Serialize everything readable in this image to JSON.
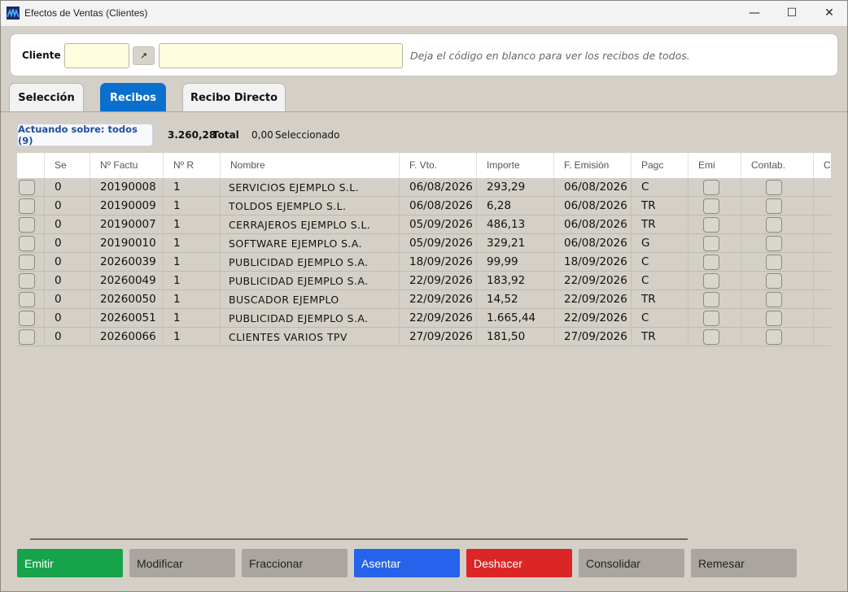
{
  "window": {
    "title": "Efectos de Ventas (Clientes)",
    "minimize_glyph": "—",
    "maximize_glyph": "☐",
    "close_glyph": "✕"
  },
  "client": {
    "label": "Cliente",
    "code_value": "",
    "name_value": "",
    "link_glyph": "↗",
    "hint": "Deja el código en blanco para ver los recibos de todos."
  },
  "tabs": [
    {
      "label": "Selección",
      "active": false
    },
    {
      "label": "Recibos",
      "active": true
    },
    {
      "label": "Recibo Directo",
      "active": false
    }
  ],
  "status": {
    "acting": "Actuando sobre: todos (9)",
    "total_amount": "3.260,28",
    "total_label": "Total",
    "selected_amount": "0,00",
    "selected_label": "Seleccionado"
  },
  "grid": {
    "headers": [
      "Se",
      "Nº Factu",
      "Nº R",
      "Nombre",
      "F. Vto.",
      "Importe",
      "F. Emisión",
      "Pagc",
      "Emi",
      "Contab.",
      "Co"
    ],
    "rows": [
      {
        "serie": "0",
        "factura": "20190008",
        "recibo": "1",
        "nombre": "SERVICIOS EJEMPLO S.L.",
        "vto": "06/08/2026",
        "importe": "293,29",
        "emision": "06/08/2026",
        "pago": "C"
      },
      {
        "serie": "0",
        "factura": "20190009",
        "recibo": "1",
        "nombre": "TOLDOS EJEMPLO S.L.",
        "vto": "06/08/2026",
        "importe": "6,28",
        "emision": "06/08/2026",
        "pago": "TR"
      },
      {
        "serie": "0",
        "factura": "20190007",
        "recibo": "1",
        "nombre": "CERRAJEROS EJEMPLO S.L.",
        "vto": "05/09/2026",
        "importe": "486,13",
        "emision": "06/08/2026",
        "pago": "TR"
      },
      {
        "serie": "0",
        "factura": "20190010",
        "recibo": "1",
        "nombre": "SOFTWARE EJEMPLO S.A.",
        "vto": "05/09/2026",
        "importe": "329,21",
        "emision": "06/08/2026",
        "pago": "G"
      },
      {
        "serie": "0",
        "factura": "20260039",
        "recibo": "1",
        "nombre": "PUBLICIDAD EJEMPLO S.A.",
        "vto": "18/09/2026",
        "importe": "99,99",
        "emision": "18/09/2026",
        "pago": "C"
      },
      {
        "serie": "0",
        "factura": "20260049",
        "recibo": "1",
        "nombre": "PUBLICIDAD EJEMPLO S.A.",
        "vto": "22/09/2026",
        "importe": "183,92",
        "emision": "22/09/2026",
        "pago": "C"
      },
      {
        "serie": "0",
        "factura": "20260050",
        "recibo": "1",
        "nombre": "BUSCADOR EJEMPLO",
        "vto": "22/09/2026",
        "importe": "14,52",
        "emision": "22/09/2026",
        "pago": "TR"
      },
      {
        "serie": "0",
        "factura": "20260051",
        "recibo": "1",
        "nombre": "PUBLICIDAD EJEMPLO S.A.",
        "vto": "22/09/2026",
        "importe": "1.665,44",
        "emision": "22/09/2026",
        "pago": "C"
      },
      {
        "serie": "0",
        "factura": "20260066",
        "recibo": "1",
        "nombre": "CLIENTES VARIOS TPV",
        "vto": "27/09/2026",
        "importe": "181,50",
        "emision": "27/09/2026",
        "pago": "TR"
      }
    ]
  },
  "actions": [
    {
      "label": "Emitir",
      "color": "#16a34a",
      "text_color": "#ffffff"
    },
    {
      "label": "Modificar",
      "color": "#aaa69f",
      "text_color": "#222222"
    },
    {
      "label": "Fraccionar",
      "color": "#aaa69f",
      "text_color": "#222222"
    },
    {
      "label": "Asentar",
      "color": "#2563eb",
      "text_color": "#ffffff"
    },
    {
      "label": "Deshacer",
      "color": "#dc2626",
      "text_color": "#ffffff"
    },
    {
      "label": "Consolidar",
      "color": "#aaa69f",
      "text_color": "#222222"
    },
    {
      "label": "Remesar",
      "color": "#aaa69f",
      "text_color": "#222222"
    }
  ]
}
